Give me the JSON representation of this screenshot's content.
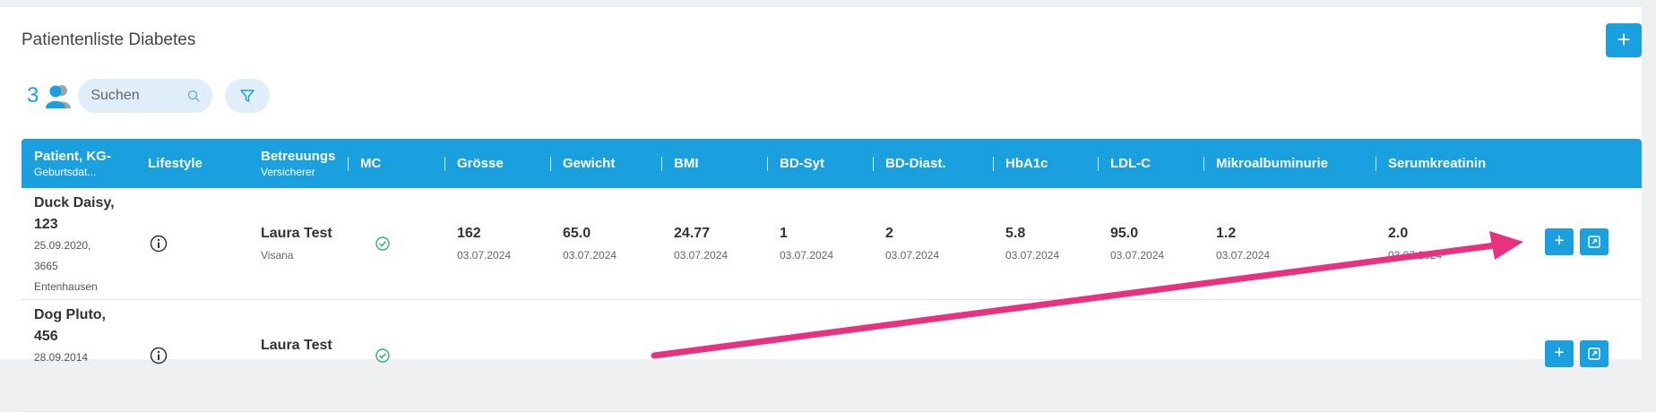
{
  "header": {
    "title": "Patientenliste Diabetes",
    "add_label": "+"
  },
  "toolbar": {
    "count": "3",
    "search_placeholder": "Suchen"
  },
  "columns": [
    {
      "label": "Patient, KG-",
      "sub": "Geburtsdat..."
    },
    {
      "label": "Lifestyle",
      "sub": ""
    },
    {
      "label": "Betreuungs",
      "sub": "Versicherer"
    },
    {
      "label": "MC",
      "sub": ""
    },
    {
      "label": "Grösse",
      "sub": ""
    },
    {
      "label": "Gewicht",
      "sub": ""
    },
    {
      "label": "BMI",
      "sub": ""
    },
    {
      "label": "BD-Syt",
      "sub": ""
    },
    {
      "label": "BD-Diast.",
      "sub": ""
    },
    {
      "label": "HbA1c",
      "sub": ""
    },
    {
      "label": "LDL-C",
      "sub": ""
    },
    {
      "label": "Mikroalbuminurie",
      "sub": ""
    },
    {
      "label": "Serumkreatinin",
      "sub": ""
    }
  ],
  "rows": [
    {
      "name": "Duck Daisy,",
      "id": "123",
      "birthdate": "25.09.2020,",
      "zip": "3665",
      "city": "Entenhausen",
      "caregiver": "Laura Test",
      "insurer": "Visana",
      "values": [
        {
          "v": "162",
          "d": "03.07.2024"
        },
        {
          "v": "65.0",
          "d": "03.07.2024"
        },
        {
          "v": "24.77",
          "d": "03.07.2024"
        },
        {
          "v": "1",
          "d": "03.07.2024"
        },
        {
          "v": "2",
          "d": "03.07.2024"
        },
        {
          "v": "5.8",
          "d": "03.07.2024"
        },
        {
          "v": "95.0",
          "d": "03.07.2024"
        },
        {
          "v": "1.2",
          "d": "03.07.2024"
        },
        {
          "v": "2.0",
          "d": "03.07.2024"
        }
      ],
      "add_label": "+"
    },
    {
      "name": "Dog Pluto,",
      "id": "456",
      "birthdate": "28.09.2014",
      "caregiver": "Laura Test",
      "add_label": "+"
    }
  ],
  "colors": {
    "accent": "#1a9fdf",
    "annotation_arrow": "#e8317f",
    "check": "#2db36f"
  }
}
